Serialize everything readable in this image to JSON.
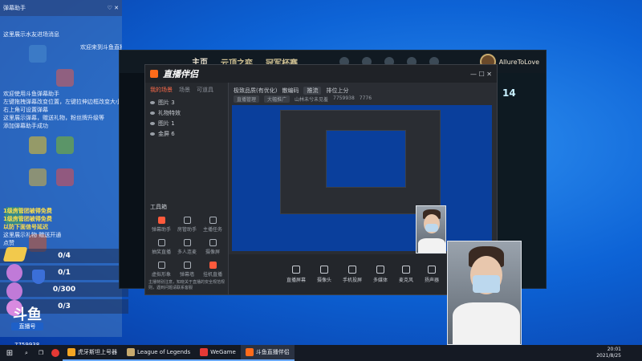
{
  "chat": {
    "top_label": "弹幕助手",
    "lines": [
      "这里展示水友进场消息",
      "欢迎来到斗鱼直播间",
      "欢迎使用斗鱼弹幕助手",
      "左键拖拽弹幕改变位置，左键拉伸边框改变大小",
      "右上角可设置弹幕",
      "这里展示弹幕，赠送礼物，粉丝牌升级等",
      "添加弹幕助手成功"
    ],
    "highlight_lines": [
      "1级房管团被得免费",
      "1级房管团被得免费",
      "以防下面信号延迟"
    ],
    "gift_lines": [
      "这里展示礼物",
      "赠送开通",
      "点赞"
    ],
    "counters": [
      "0/4",
      "0/1",
      "0/300",
      "0/3"
    ]
  },
  "lol": {
    "tabs": [
      "主页",
      "云顶之弈",
      "冠军杯赛"
    ],
    "username": "AllureToLove",
    "right_num": "14"
  },
  "stream": {
    "app_name": "直播伴侣",
    "header_title": "极致品质(有优化)",
    "header_sub": "散编码",
    "header_badge": "推流",
    "room_title": "排位上分",
    "room_info": [
      "直播管理",
      "大幅推广",
      "山林未兮未见羞",
      "7759938",
      "7776"
    ],
    "scene_tabs": [
      "我的场景",
      "场景",
      "可道具"
    ],
    "sources": [
      "图片 3",
      "礼物特效",
      "图片 1",
      "金屏 6"
    ],
    "tools_title": "工具箱",
    "tools": [
      "弹幕助手",
      "房管助手",
      "主播任务",
      "抽奖直播",
      "多人连麦",
      "摄像屏",
      "虚拟形象",
      "弹幕墙",
      "挂机直播"
    ],
    "bottom_actions": [
      "直播屏幕",
      "摄像头",
      "手机投屏",
      "多媒体",
      "麦克风",
      "扬声器"
    ],
    "notice": "主播特别注意，知晓关于直播的安全规范规则，遇到问题请联系客服"
  },
  "brand": {
    "mark": "斗鱼",
    "sub": "直播号",
    "room_id": "7759938"
  },
  "taskbar": {
    "apps": [
      {
        "label": "虎牙斯坦上号器",
        "color": "#f5a623"
      },
      {
        "label": "League of Legends",
        "color": "#c8aa6e"
      },
      {
        "label": "WeGame",
        "color": "#e53935"
      },
      {
        "label": "斗鱼直播伴侣",
        "color": "#ff6b1a"
      }
    ],
    "time": "20:01",
    "date": "2021/8/25"
  }
}
